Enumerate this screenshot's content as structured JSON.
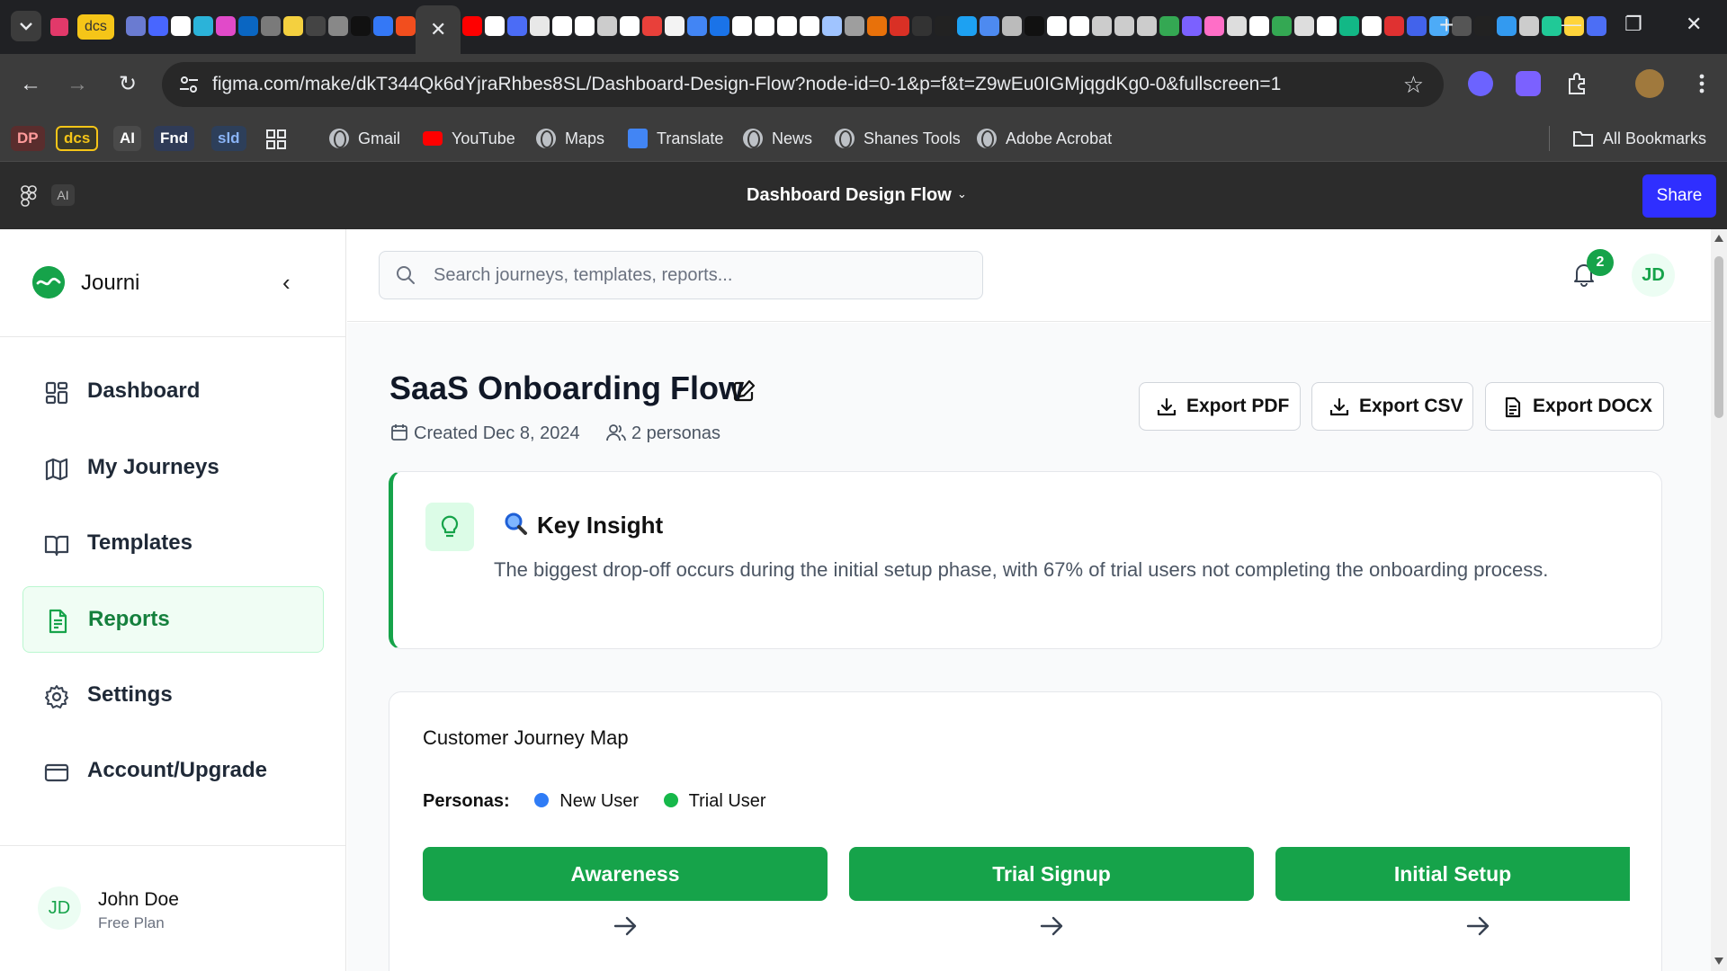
{
  "browser": {
    "tab_menu_icon": "chevron-down-icon",
    "pinned_tab_label": "dcs",
    "active_tab_close": "✕",
    "new_tab": "+",
    "window_controls": {
      "minimize": "—",
      "restore": "❐",
      "close": "✕"
    },
    "back": "←",
    "forward": "→",
    "reload": "↻",
    "url": "figma.com/make/dkT344Qk6dYjraRhbes8SL/Dashboard-Design-Flow?node-id=0-1&p=f&t=Z9wEu0IGMjqgdKg0-0&fullscreen=1",
    "star": "☆",
    "bookmarks": {
      "chips": [
        "DP",
        "dcs",
        "AI",
        "Fnd",
        "sld"
      ],
      "items": [
        "Gmail",
        "YouTube",
        "Maps",
        "Translate",
        "News",
        "Shanes Tools",
        "Adobe Acrobat"
      ],
      "all_bookmarks": "All Bookmarks"
    }
  },
  "figma": {
    "ai_badge": "AI",
    "file_title": "Dashboard Design Flow",
    "caret": "⌄",
    "share_label": "Share",
    "share_color": "#2f2fff"
  },
  "app": {
    "brand": {
      "name": "Journi",
      "collapse": "‹",
      "color": "#16a34a"
    },
    "nav": [
      {
        "label": "Dashboard",
        "icon": "dashboard-grid-icon",
        "active": false
      },
      {
        "label": "My Journeys",
        "icon": "map-icon",
        "active": false
      },
      {
        "label": "Templates",
        "icon": "book-open-icon",
        "active": false
      },
      {
        "label": "Reports",
        "icon": "document-icon",
        "active": true
      },
      {
        "label": "Settings",
        "icon": "gear-icon",
        "active": false
      },
      {
        "label": "Account/Upgrade",
        "icon": "credit-card-icon",
        "active": false
      }
    ],
    "user": {
      "initials": "JD",
      "name": "John Doe",
      "plan": "Free Plan"
    },
    "search": {
      "placeholder": "Search journeys, templates, reports...",
      "value": ""
    },
    "notifications": {
      "count": "2"
    },
    "avatar_initials": "JD",
    "page": {
      "title": "SaaS Onboarding Flow",
      "created": "Created Dec 8, 2024",
      "personas_count": "2 personas",
      "exports": [
        "Export PDF",
        "Export CSV",
        "Export DOCX"
      ]
    },
    "insight": {
      "title": "Key Insight",
      "emoji": "🔍",
      "text": "The biggest drop-off occurs during the initial setup phase, with 67% of trial users not completing the onboarding process.",
      "accent": "#16a34a"
    },
    "journey_map": {
      "title": "Customer Journey Map",
      "personas_label": "Personas:",
      "personas": [
        {
          "name": "New User",
          "color": "#2f7cf6"
        },
        {
          "name": "Trial User",
          "color": "#16b84a"
        }
      ],
      "stages": [
        "Awareness",
        "Trial Signup",
        "Initial Setup"
      ],
      "stage_color": "#16a34a"
    }
  }
}
